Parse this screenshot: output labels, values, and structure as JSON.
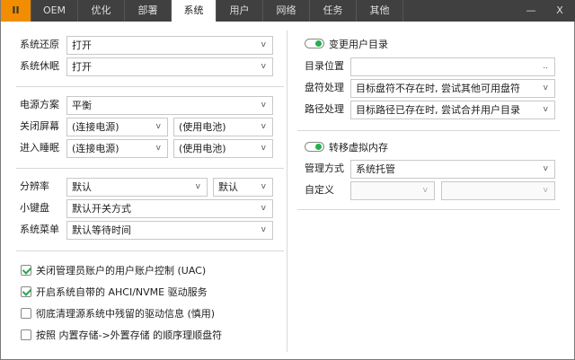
{
  "tabs": [
    "II",
    "OEM",
    "优化",
    "部署",
    "系统",
    "用户",
    "网络",
    "任务",
    "其他"
  ],
  "active_tab": "系统",
  "window_controls": {
    "minimize": "—",
    "close": "X"
  },
  "left": {
    "restore": {
      "label": "系统还原",
      "value": "打开"
    },
    "hibernate": {
      "label": "系统休眠",
      "value": "打开"
    },
    "power_plan": {
      "label": "电源方案",
      "value": "平衡"
    },
    "screen_off": {
      "label": "关闭屏幕",
      "ac": "(连接电源)",
      "battery": "(使用电池)"
    },
    "sleep": {
      "label": "进入睡眠",
      "ac": "(连接电源)",
      "battery": "(使用电池)"
    },
    "resolution": {
      "label": "分辨率",
      "value": "默认",
      "value2": "默认"
    },
    "numpad": {
      "label": "小键盘",
      "value": "默认开关方式"
    },
    "boot_menu": {
      "label": "系统菜单",
      "value": "默认等待时间"
    },
    "checkboxes": [
      {
        "label": "关闭管理员账户的用户账户控制 (UAC)",
        "checked": true
      },
      {
        "label": "开启系统自带的 AHCI/NVME 驱动服务",
        "checked": true
      },
      {
        "label": "彻底清理源系统中残留的驱动信息 (慎用)",
        "checked": false
      },
      {
        "label": "按照 内置存储->外置存储 的顺序理顺盘符",
        "checked": false
      }
    ]
  },
  "right": {
    "user_dir_toggle": {
      "label": "变更用户目录",
      "on": true
    },
    "dir_location": {
      "label": "目录位置",
      "value": "",
      "browse": ".."
    },
    "drive_handling": {
      "label": "盘符处理",
      "value": "目标盘符不存在时, 尝试其他可用盘符"
    },
    "path_handling": {
      "label": "路径处理",
      "value": "目标路径已存在时, 尝试合并用户目录"
    },
    "pagefile_toggle": {
      "label": "转移虚拟内存",
      "on": true
    },
    "manage_mode": {
      "label": "管理方式",
      "value": "系统托管"
    },
    "custom": {
      "label": "自定义",
      "value1": "",
      "value2": ""
    }
  },
  "arrow": "v"
}
